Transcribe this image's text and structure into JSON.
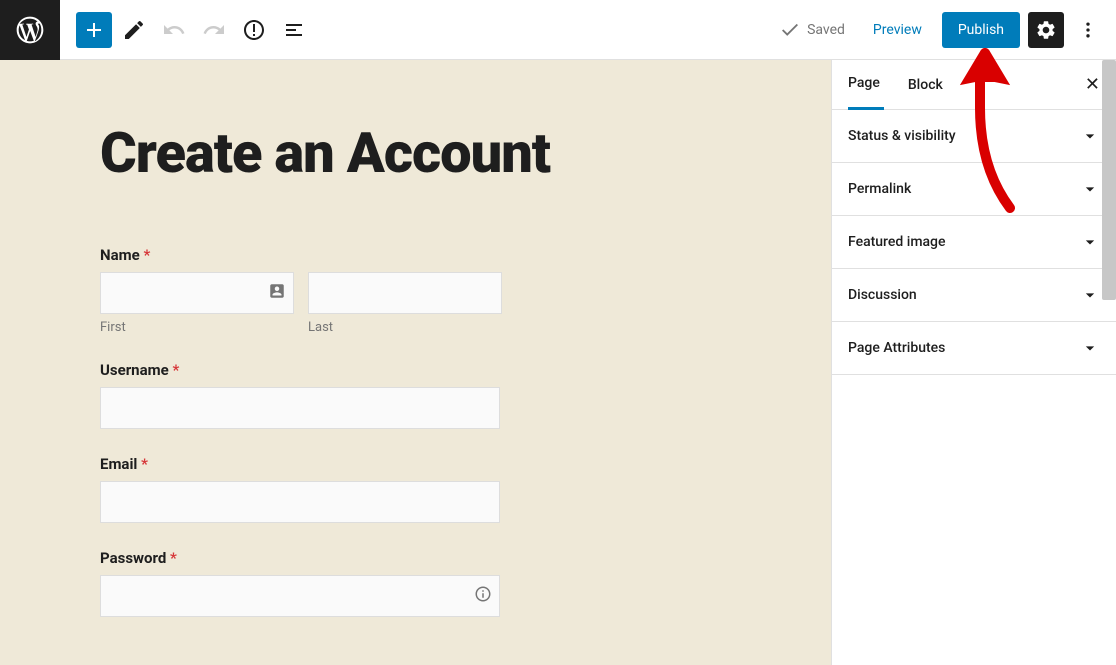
{
  "topbar": {
    "saved_label": "Saved",
    "preview_label": "Preview",
    "publish_label": "Publish"
  },
  "editor": {
    "title": "Create an Account",
    "fields": {
      "name": {
        "label": "Name",
        "first_sub": "First",
        "last_sub": "Last"
      },
      "username": {
        "label": "Username"
      },
      "email": {
        "label": "Email"
      },
      "password": {
        "label": "Password"
      }
    },
    "required_mark": "*"
  },
  "sidebar": {
    "tabs": {
      "page": "Page",
      "block": "Block"
    },
    "panels": [
      {
        "label": "Status & visibility"
      },
      {
        "label": "Permalink"
      },
      {
        "label": "Featured image"
      },
      {
        "label": "Discussion"
      },
      {
        "label": "Page Attributes"
      }
    ]
  }
}
